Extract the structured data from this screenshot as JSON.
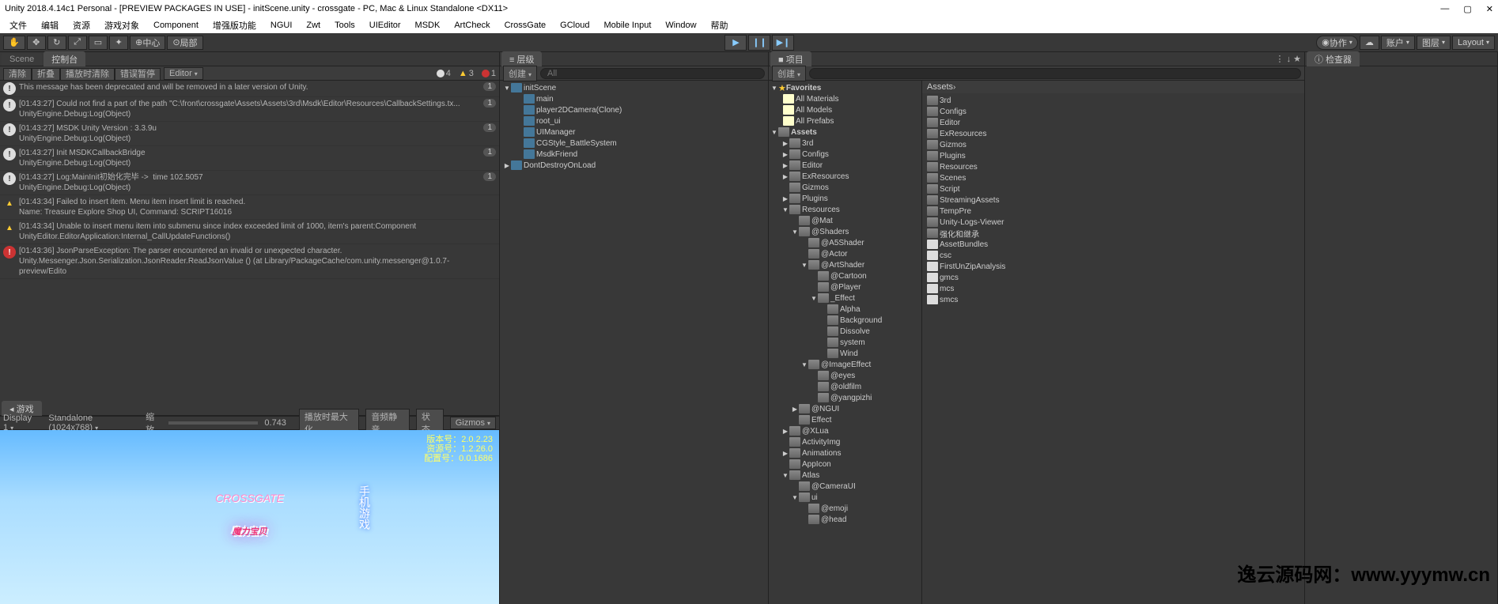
{
  "title": "Unity 2018.4.14c1 Personal - [PREVIEW PACKAGES IN USE] - initScene.unity - crossgate - PC, Mac & Linux Standalone <DX11>",
  "menu": [
    "文件",
    "编辑",
    "资源",
    "游戏对象",
    "Component",
    "增强版功能",
    "NGUI",
    "Zwt",
    "Tools",
    "UIEditor",
    "MSDK",
    "ArtCheck",
    "CrossGate",
    "GCloud",
    "Mobile Input",
    "Window",
    "帮助"
  ],
  "toolbar": {
    "center_label": "中心",
    "local_label": "局部",
    "collab": "协作",
    "account": "账户",
    "layers": "图层",
    "layout": "Layout"
  },
  "tabs": {
    "scene": "Scene",
    "console": "控制台",
    "game": "游戏",
    "hierarchy": "层级",
    "project": "项目",
    "inspector": "检查器"
  },
  "console_tools": [
    "清除",
    "折叠",
    "播放时清除",
    "错误暂停",
    "Editor"
  ],
  "console_badges": {
    "info": "4",
    "warn": "3",
    "err": "1"
  },
  "logs": [
    {
      "type": "info",
      "text": "This message has been deprecated and will be removed in a later version of Unity.",
      "count": "1"
    },
    {
      "type": "info",
      "text": "[01:43:27] Could not find a part of the path \"C:\\front\\crossgate\\Assets\\Assets\\3rd\\Msdk\\Editor\\Resources\\CallbackSettings.tx...\nUnityEngine.Debug:Log(Object)",
      "count": "1"
    },
    {
      "type": "info",
      "text": "[01:43:27] MSDK Unity Version : 3.3.9u\nUnityEngine.Debug:Log(Object)",
      "count": "1"
    },
    {
      "type": "info",
      "text": "[01:43:27] Init MSDKCallbackBridge\nUnityEngine.Debug:Log(Object)",
      "count": "1"
    },
    {
      "type": "info",
      "text": "[01:43:27] Log:MainInit初始化完毕 ->  time 102.5057\nUnityEngine.Debug:Log(Object)",
      "count": "1"
    },
    {
      "type": "warn",
      "text": "[01:43:34] Failed to insert item. Menu item insert limit is reached.\nName: Treasure Explore Shop UI, Command: SCRIPT16016",
      "count": ""
    },
    {
      "type": "warn",
      "text": "[01:43:34] Unable to insert menu item into submenu since index exceeded limit of 1000, item's parent:Component\nUnityEditor.EditorApplication:Internal_CallUpdateFunctions()",
      "count": ""
    },
    {
      "type": "err",
      "text": "[01:43:36] JsonParseException: The parser encountered an invalid or unexpected character.\nUnity.Messenger.Json.Serialization.JsonReader.ReadJsonValue () (at Library/PackageCache/com.unity.messenger@1.0.7-preview/Edito",
      "count": ""
    }
  ],
  "game": {
    "display": "Display 1",
    "res": "Standalone (1024x768)",
    "scale": "缩放",
    "scaleVal": "0.743",
    "maximize": "播放时最大化",
    "mute": "音频静音",
    "stats": "状态",
    "gizmos": "Gizmos"
  },
  "gamebadge": {
    "l1": "版本号：2.0.2.23",
    "l2": "资源号：1.2.26.0",
    "l3": "配置号：0.0.1686"
  },
  "gamelogo": "魔力宝贝",
  "gamelogo2": "CROSSGATE",
  "gameside": "手机游戏",
  "hier": {
    "create": "创建",
    "search_ph": "All"
  },
  "hierarchy": [
    {
      "d": 0,
      "a": "▼",
      "i": "unity",
      "t": "initScene"
    },
    {
      "d": 1,
      "a": "",
      "i": "cube",
      "t": "main"
    },
    {
      "d": 1,
      "a": "",
      "i": "cube",
      "t": "player2DCamera(Clone)"
    },
    {
      "d": 1,
      "a": "",
      "i": "cube",
      "t": "root_ui"
    },
    {
      "d": 1,
      "a": "",
      "i": "cube",
      "t": "UIManager"
    },
    {
      "d": 1,
      "a": "",
      "i": "cube",
      "t": "CGStyle_BattleSystem"
    },
    {
      "d": 1,
      "a": "",
      "i": "cube",
      "t": "MsdkFriend"
    },
    {
      "d": 0,
      "a": "▶",
      "i": "unity",
      "t": "DontDestroyOnLoad"
    }
  ],
  "proj": {
    "create": "创建"
  },
  "favorites": "Favorites",
  "fav_items": [
    "All Materials",
    "All Models",
    "All Prefabs"
  ],
  "assets_root": "Assets",
  "project_tree": [
    {
      "d": 1,
      "a": "▶",
      "t": "3rd"
    },
    {
      "d": 1,
      "a": "▶",
      "t": "Configs"
    },
    {
      "d": 1,
      "a": "▶",
      "t": "Editor"
    },
    {
      "d": 1,
      "a": "▶",
      "t": "ExResources"
    },
    {
      "d": 1,
      "a": "",
      "t": "Gizmos"
    },
    {
      "d": 1,
      "a": "▶",
      "t": "Plugins"
    },
    {
      "d": 1,
      "a": "▼",
      "t": "Resources"
    },
    {
      "d": 2,
      "a": "",
      "t": "@Mat"
    },
    {
      "d": 2,
      "a": "▼",
      "t": "@Shaders"
    },
    {
      "d": 3,
      "a": "",
      "t": "@A5Shader"
    },
    {
      "d": 3,
      "a": "",
      "t": "@Actor"
    },
    {
      "d": 3,
      "a": "▼",
      "t": "@ArtShader"
    },
    {
      "d": 4,
      "a": "",
      "t": "@Cartoon"
    },
    {
      "d": 4,
      "a": "",
      "t": "@Player"
    },
    {
      "d": 4,
      "a": "▼",
      "t": "_Effect"
    },
    {
      "d": 5,
      "a": "",
      "t": "Alpha"
    },
    {
      "d": 5,
      "a": "",
      "t": "Background"
    },
    {
      "d": 5,
      "a": "",
      "t": "Dissolve"
    },
    {
      "d": 5,
      "a": "",
      "t": "system"
    },
    {
      "d": 5,
      "a": "",
      "t": "Wind"
    },
    {
      "d": 3,
      "a": "▼",
      "t": "@ImageEffect"
    },
    {
      "d": 4,
      "a": "",
      "t": "@eyes"
    },
    {
      "d": 4,
      "a": "",
      "t": "@oldfilm"
    },
    {
      "d": 4,
      "a": "",
      "t": "@yangpizhi"
    },
    {
      "d": 2,
      "a": "▶",
      "t": "@NGUI"
    },
    {
      "d": 2,
      "a": "",
      "t": "Effect"
    },
    {
      "d": 1,
      "a": "▶",
      "t": "@XLua"
    },
    {
      "d": 1,
      "a": "",
      "t": "ActivityImg"
    },
    {
      "d": 1,
      "a": "▶",
      "t": "Animations"
    },
    {
      "d": 1,
      "a": "",
      "t": "AppIcon"
    },
    {
      "d": 1,
      "a": "▼",
      "t": "Atlas"
    },
    {
      "d": 2,
      "a": "",
      "t": "@CameraUI"
    },
    {
      "d": 2,
      "a": "▼",
      "t": "ui"
    },
    {
      "d": 3,
      "a": "",
      "t": "@emoji"
    },
    {
      "d": 3,
      "a": "",
      "t": "@head"
    }
  ],
  "assets_label": "Assets",
  "assets_list": [
    {
      "i": "folder",
      "t": "3rd"
    },
    {
      "i": "folder",
      "t": "Configs"
    },
    {
      "i": "folder",
      "t": "Editor"
    },
    {
      "i": "folder",
      "t": "ExResources"
    },
    {
      "i": "folder",
      "t": "Gizmos"
    },
    {
      "i": "folder",
      "t": "Plugins"
    },
    {
      "i": "folder",
      "t": "Resources"
    },
    {
      "i": "folder",
      "t": "Scenes"
    },
    {
      "i": "folder",
      "t": "Script"
    },
    {
      "i": "folder",
      "t": "StreamingAssets"
    },
    {
      "i": "folder",
      "t": "TempPre"
    },
    {
      "i": "folder",
      "t": "Unity-Logs-Viewer"
    },
    {
      "i": "folder",
      "t": "强化和继承"
    },
    {
      "i": "file",
      "t": "AssetBundles"
    },
    {
      "i": "file",
      "t": "csc"
    },
    {
      "i": "file",
      "t": "FirstUnZipAnalysis"
    },
    {
      "i": "file",
      "t": "gmcs"
    },
    {
      "i": "file",
      "t": "mcs"
    },
    {
      "i": "file",
      "t": "smcs"
    }
  ],
  "watermark": "逸云源码网：www.yyymw.cn"
}
